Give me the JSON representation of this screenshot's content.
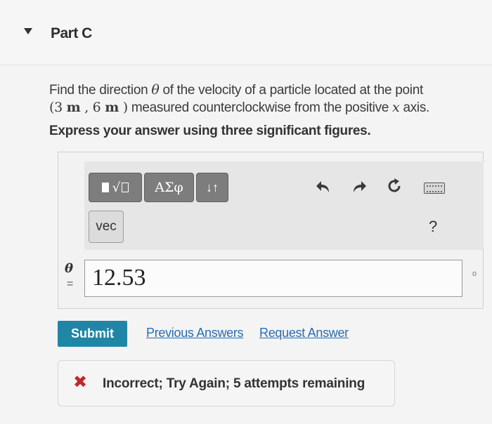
{
  "part": {
    "title": "Part C"
  },
  "question": {
    "text_1": "Find the direction ",
    "theta": "θ",
    "text_2": " of the velocity of a particle located at the point",
    "point_open": "(3 ",
    "unit_m1": "m",
    "point_mid": " , 6 ",
    "unit_m2": "m",
    "point_close": " )",
    "text_3": " measured counterclockwise from the positive ",
    "axis_var": "x",
    "text_4": " axis.",
    "instruction": "Express your answer using three significant figures."
  },
  "toolbar": {
    "templates_sqrt": "√",
    "greek_label": "ΑΣφ",
    "arrows_label": "↓↑",
    "vec_label": "vec",
    "undo_icon": "undo-icon",
    "redo_icon": "redo-icon",
    "reset_icon": "reset-icon",
    "keyboard_icon": "keyboard-icon",
    "help_label": "?"
  },
  "answer": {
    "variable": "θ",
    "equals": "=",
    "value": "12.53",
    "side_mark": "o"
  },
  "actions": {
    "submit_label": "Submit",
    "previous_answers": "Previous Answers",
    "request_answer": "Request Answer"
  },
  "feedback": {
    "icon": "✖",
    "message": "Incorrect; Try Again; 5 attempts remaining"
  },
  "colors": {
    "submit": "#1f86a6",
    "link": "#2a6db0",
    "error": "#c0282b"
  }
}
